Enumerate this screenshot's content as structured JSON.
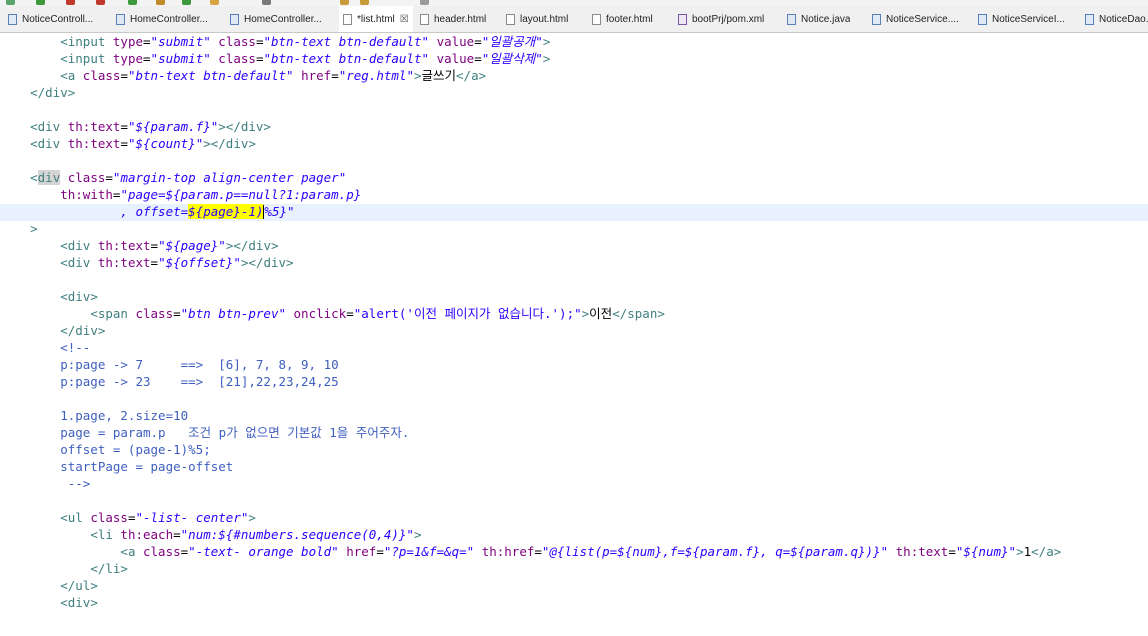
{
  "tabs": [
    {
      "label": "NoticeControll...",
      "type": "java",
      "active": false
    },
    {
      "label": "HomeController...",
      "type": "java",
      "active": false
    },
    {
      "label": "HomeController...",
      "type": "java",
      "active": false
    },
    {
      "label": "*list.html",
      "type": "html",
      "active": true
    },
    {
      "label": "header.html",
      "type": "html",
      "active": false
    },
    {
      "label": "layout.html",
      "type": "html",
      "active": false
    },
    {
      "label": "footer.html",
      "type": "html",
      "active": false
    },
    {
      "label": "bootPrj/pom.xml",
      "type": "xml",
      "active": false
    },
    {
      "label": "Notice.java",
      "type": "java",
      "active": false
    },
    {
      "label": "NoticeService....",
      "type": "java",
      "active": false
    },
    {
      "label": "NoticeServiceI...",
      "type": "java",
      "active": false
    },
    {
      "label": "NoticeDao.ja",
      "type": "java",
      "active": false
    }
  ],
  "tab_close_glyph": "☒",
  "colors": {
    "tag": "#3f7f7f",
    "attribute": "#7f007f",
    "value": "#2a00ff",
    "comment": "#3f5fbf",
    "highlight": "#ffff00",
    "current_line": "#e8f2fe"
  },
  "code_lines": [
    [
      [
        "txt",
        "        "
      ],
      [
        "tag",
        "<input "
      ],
      [
        "attr",
        "type"
      ],
      [
        "txt",
        "="
      ],
      [
        "val",
        "\"submit\""
      ],
      [
        "txt",
        " "
      ],
      [
        "attr",
        "class"
      ],
      [
        "txt",
        "="
      ],
      [
        "val",
        "\"btn-text btn-default\""
      ],
      [
        "txt",
        " "
      ],
      [
        "attr",
        "value"
      ],
      [
        "txt",
        "="
      ],
      [
        "val",
        "\"일괄공개\""
      ],
      [
        "tag",
        ">"
      ]
    ],
    [
      [
        "txt",
        "        "
      ],
      [
        "tag",
        "<input "
      ],
      [
        "attr",
        "type"
      ],
      [
        "txt",
        "="
      ],
      [
        "val",
        "\"submit\""
      ],
      [
        "txt",
        " "
      ],
      [
        "attr",
        "class"
      ],
      [
        "txt",
        "="
      ],
      [
        "val",
        "\"btn-text btn-default\""
      ],
      [
        "txt",
        " "
      ],
      [
        "attr",
        "value"
      ],
      [
        "txt",
        "="
      ],
      [
        "val",
        "\"일괄삭제\""
      ],
      [
        "tag",
        ">"
      ]
    ],
    [
      [
        "txt",
        "        "
      ],
      [
        "tag",
        "<a "
      ],
      [
        "attr",
        "class"
      ],
      [
        "txt",
        "="
      ],
      [
        "val",
        "\"btn-text btn-default\""
      ],
      [
        "txt",
        " "
      ],
      [
        "attr",
        "href"
      ],
      [
        "txt",
        "="
      ],
      [
        "val",
        "\"reg.html\""
      ],
      [
        "tag",
        ">"
      ],
      [
        "txt",
        "글쓰기"
      ],
      [
        "tag",
        "</a>"
      ]
    ],
    [
      [
        "txt",
        "    "
      ],
      [
        "tag",
        "</div>"
      ]
    ],
    [],
    [
      [
        "txt",
        "    "
      ],
      [
        "tag",
        "<div "
      ],
      [
        "attr",
        "th:text"
      ],
      [
        "txt",
        "="
      ],
      [
        "val",
        "\"${param.f}\""
      ],
      [
        "tag",
        "></div>"
      ]
    ],
    [
      [
        "txt",
        "    "
      ],
      [
        "tag",
        "<div "
      ],
      [
        "attr",
        "th:text"
      ],
      [
        "txt",
        "="
      ],
      [
        "val",
        "\"${count}\""
      ],
      [
        "tag",
        "></div>"
      ]
    ],
    [],
    [
      [
        "txt",
        "    "
      ],
      [
        "tag",
        "<"
      ],
      [
        "tag-gray",
        "div"
      ],
      [
        "txt",
        " "
      ],
      [
        "attr",
        "class"
      ],
      [
        "txt",
        "="
      ],
      [
        "val",
        "\"margin-top align-center pager\""
      ]
    ],
    [
      [
        "txt",
        "        "
      ],
      [
        "attr",
        "th:with"
      ],
      [
        "txt",
        "="
      ],
      [
        "val",
        "\"page=${param.p==null?1:param.p}"
      ]
    ],
    [
      [
        "txt",
        "                "
      ],
      [
        "val",
        ", offset="
      ],
      [
        "val-hl",
        "${page}-1)"
      ],
      [
        "caret",
        ""
      ],
      [
        "val",
        "%5}\""
      ]
    ],
    [
      [
        "txt",
        "    "
      ],
      [
        "tag",
        ">"
      ]
    ],
    [
      [
        "txt",
        "        "
      ],
      [
        "tag",
        "<div "
      ],
      [
        "attr",
        "th:text"
      ],
      [
        "txt",
        "="
      ],
      [
        "val",
        "\"${page}\""
      ],
      [
        "tag",
        "></div>"
      ]
    ],
    [
      [
        "txt",
        "        "
      ],
      [
        "tag",
        "<div "
      ],
      [
        "attr",
        "th:text"
      ],
      [
        "txt",
        "="
      ],
      [
        "val",
        "\"${offset}\""
      ],
      [
        "tag",
        "></div>"
      ]
    ],
    [],
    [
      [
        "txt",
        "        "
      ],
      [
        "tag",
        "<div>"
      ]
    ],
    [
      [
        "txt",
        "            "
      ],
      [
        "tag",
        "<span "
      ],
      [
        "attr",
        "class"
      ],
      [
        "txt",
        "="
      ],
      [
        "val",
        "\"btn btn-prev\""
      ],
      [
        "txt",
        " "
      ],
      [
        "attr",
        "onclick"
      ],
      [
        "txt",
        "="
      ],
      [
        "valn",
        "\"alert('이전 페이지가 없습니다.');\""
      ],
      [
        "tag",
        ">"
      ],
      [
        "txt",
        "이전"
      ],
      [
        "tag",
        "</span>"
      ]
    ],
    [
      [
        "txt",
        "        "
      ],
      [
        "tag",
        "</div>"
      ]
    ],
    [
      [
        "txt",
        "        "
      ],
      [
        "cmt",
        "<!--"
      ]
    ],
    [
      [
        "cmt",
        "        p:page -> 7     ==>  [6], 7, 8, 9, 10"
      ]
    ],
    [
      [
        "cmt",
        "        p:page -> 23    ==>  [21],22,23,24,25"
      ]
    ],
    [],
    [
      [
        "cmt",
        "        1.page, 2.size=10"
      ]
    ],
    [
      [
        "cmt",
        "        page = param.p   조건 p가 없으면 기본값 1을 주어주자."
      ]
    ],
    [
      [
        "cmt",
        "        offset = (page-1)%5;"
      ]
    ],
    [
      [
        "cmt",
        "        startPage = page-offset"
      ]
    ],
    [
      [
        "cmt",
        "         -->"
      ]
    ],
    [],
    [
      [
        "txt",
        "        "
      ],
      [
        "tag",
        "<ul "
      ],
      [
        "attr",
        "class"
      ],
      [
        "txt",
        "="
      ],
      [
        "val",
        "\"-list- center\""
      ],
      [
        "tag",
        ">"
      ]
    ],
    [
      [
        "txt",
        "            "
      ],
      [
        "tag",
        "<li "
      ],
      [
        "attr",
        "th:each"
      ],
      [
        "txt",
        "="
      ],
      [
        "val",
        "\"num:${#numbers.sequence(0,4)}\""
      ],
      [
        "tag",
        ">"
      ]
    ],
    [
      [
        "txt",
        "                "
      ],
      [
        "tag",
        "<a "
      ],
      [
        "attr",
        "class"
      ],
      [
        "txt",
        "="
      ],
      [
        "val",
        "\"-text- orange bold\""
      ],
      [
        "txt",
        " "
      ],
      [
        "attr",
        "href"
      ],
      [
        "txt",
        "="
      ],
      [
        "val",
        "\"?p=1&f=&q=\""
      ],
      [
        "txt",
        " "
      ],
      [
        "attr",
        "th:href"
      ],
      [
        "txt",
        "="
      ],
      [
        "val",
        "\"@{list(p=${num},f=${param.f}, q=${param.q})}\""
      ],
      [
        "txt",
        " "
      ],
      [
        "attr",
        "th:text"
      ],
      [
        "txt",
        "="
      ],
      [
        "val",
        "\"${num}\""
      ],
      [
        "tag",
        ">"
      ],
      [
        "txt",
        "1"
      ],
      [
        "tag",
        "</a>"
      ]
    ],
    [
      [
        "txt",
        "            "
      ],
      [
        "tag",
        "</li>"
      ]
    ],
    [
      [
        "txt",
        "        "
      ],
      [
        "tag",
        "</ul>"
      ]
    ],
    [
      [
        "txt",
        "        "
      ],
      [
        "tag",
        "<div>"
      ]
    ]
  ]
}
